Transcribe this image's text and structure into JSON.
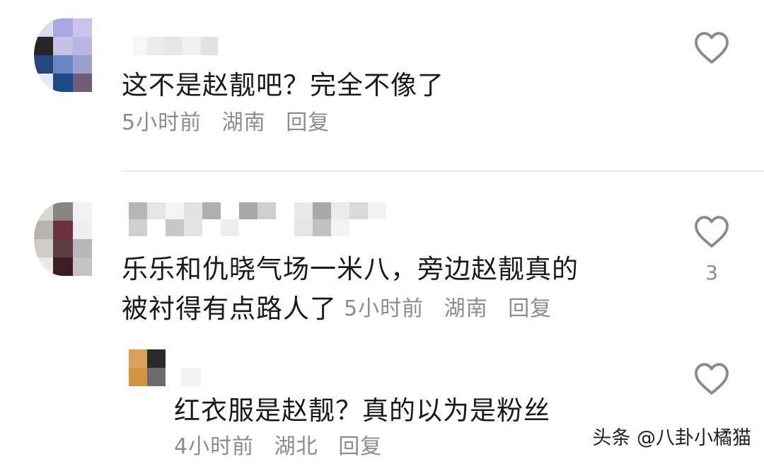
{
  "comments": [
    {
      "text": "这不是赵靓吧？完全不像了",
      "time": "5小时前",
      "location": "湖南",
      "reply_label": "回复"
    },
    {
      "text_line1": "乐乐和仇晓气场一米八，旁边赵靓真的",
      "text_line2": "被衬得有点路人了",
      "time": "5小时前",
      "location": "湖南",
      "reply_label": "回复",
      "like_count": "3",
      "replies": [
        {
          "text": "红衣服是赵靓？真的以为是粉丝",
          "time": "4小时前",
          "location": "湖北",
          "reply_label": "回复"
        }
      ]
    }
  ],
  "icons": {
    "like": "heart-outline-icon"
  },
  "colors": {
    "text": "#1a1a1a",
    "meta": "#8c8c8c",
    "divider": "#ececec",
    "icon_stroke": "#8a8a8a"
  },
  "watermark": "头条 @八卦小橘猫"
}
